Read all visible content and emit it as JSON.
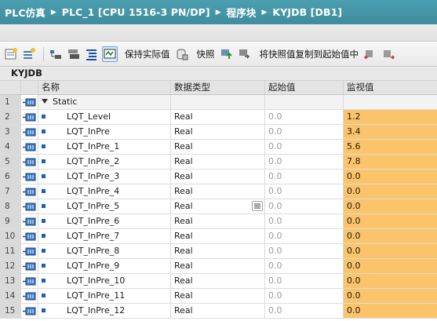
{
  "breadcrumb": [
    "PLC仿真",
    "PLC_1 [CPU 1516-3 PN/DP]",
    "程序块",
    "KYJDB [DB1]"
  ],
  "toolbar": {
    "keep_actual": "保持实际值",
    "snapshot": "快照",
    "copy_snapshot": "将快照值复制到起始值中"
  },
  "block_name": "KYJDB",
  "columns": {
    "name": "名称",
    "type": "数据类型",
    "start": "起始值",
    "monitor": "监视值"
  },
  "rows": [
    {
      "num": "1",
      "name": "Static",
      "type": "",
      "start": "",
      "monitor": ""
    },
    {
      "num": "2",
      "name": "LQT_Level",
      "type": "Real",
      "start": "0.0",
      "monitor": "1.2"
    },
    {
      "num": "3",
      "name": "LQT_InPre",
      "type": "Real",
      "start": "0.0",
      "monitor": "3.4"
    },
    {
      "num": "4",
      "name": "LQT_InPre_1",
      "type": "Real",
      "start": "0.0",
      "monitor": "5.6"
    },
    {
      "num": "5",
      "name": "LQT_InPre_2",
      "type": "Real",
      "start": "0.0",
      "monitor": "7.8"
    },
    {
      "num": "6",
      "name": "LQT_InPre_3",
      "type": "Real",
      "start": "0.0",
      "monitor": "0.0"
    },
    {
      "num": "7",
      "name": "LQT_InPre_4",
      "type": "Real",
      "start": "0.0",
      "monitor": "0.0"
    },
    {
      "num": "8",
      "name": "LQT_InPre_5",
      "type": "Real",
      "start": "0.0",
      "monitor": "0.0"
    },
    {
      "num": "9",
      "name": "LQT_InPre_6",
      "type": "Real",
      "start": "0.0",
      "monitor": "0.0"
    },
    {
      "num": "10",
      "name": "LQT_InPre_7",
      "type": "Real",
      "start": "0.0",
      "monitor": "0.0"
    },
    {
      "num": "11",
      "name": "LQT_InPre_8",
      "type": "Real",
      "start": "0.0",
      "monitor": "0.0"
    },
    {
      "num": "12",
      "name": "LQT_InPre_9",
      "type": "Real",
      "start": "0.0",
      "monitor": "0.0"
    },
    {
      "num": "13",
      "name": "LQT_InPre_10",
      "type": "Real",
      "start": "0.0",
      "monitor": "0.0"
    },
    {
      "num": "14",
      "name": "LQT_InPre_11",
      "type": "Real",
      "start": "0.0",
      "monitor": "0.0"
    },
    {
      "num": "15",
      "name": "LQT_InPre_12",
      "type": "Real",
      "start": "0.0",
      "monitor": "0.0"
    }
  ],
  "colors": {
    "title_bar": "#4497a8",
    "monitor_cell": "#fcc46a",
    "row_header": "#d9d9d9",
    "bullet": "#1f5fb3"
  }
}
